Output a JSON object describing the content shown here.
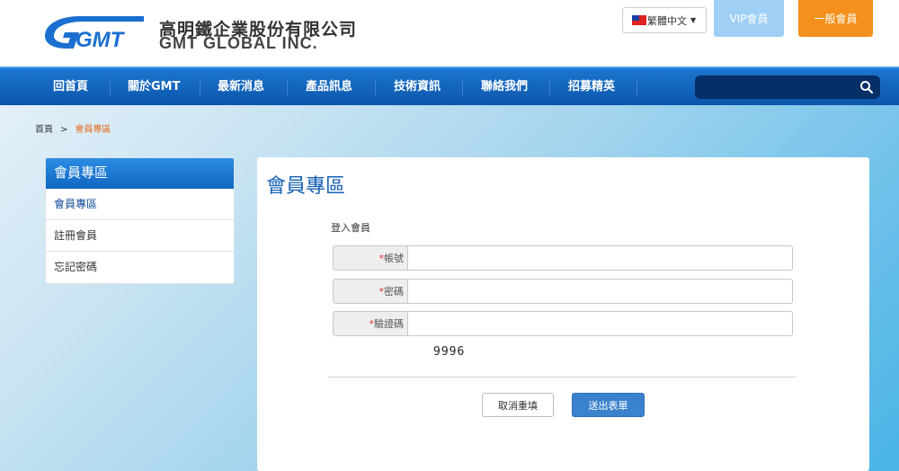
{
  "brand": {
    "name_cn": "高明鐵企業股份有限公司",
    "name_en": "GMT GLOBAL INC.",
    "logo_mark": "GMT",
    "brand_color": "#1a6fd0"
  },
  "header": {
    "language": "繁體中文",
    "vip_label": "VIP會員",
    "general_label": "一般會員"
  },
  "nav": {
    "items": [
      "回首頁",
      "關於GMT",
      "最新消息",
      "產品訊息",
      "技術資訊",
      "聯絡我們",
      "招募精英"
    ],
    "search_placeholder": ""
  },
  "breadcrumb": {
    "home": "首頁",
    "separator": ">",
    "current": "會員專區"
  },
  "sidebar": {
    "title": "會員專區",
    "items": [
      {
        "label": "會員專區"
      },
      {
        "label": "註冊會員"
      },
      {
        "label": "忘記密碼"
      }
    ]
  },
  "main": {
    "title": "會員專區",
    "form_title": "登入會員",
    "fields": [
      {
        "required": "*",
        "label": "帳號",
        "value": ""
      },
      {
        "required": "*",
        "label": "密碼",
        "value": ""
      },
      {
        "required": "*",
        "label": "驗證碼",
        "value": ""
      }
    ],
    "captcha": "9996",
    "cancel_label": "取消重填",
    "submit_label": "送出表單"
  }
}
